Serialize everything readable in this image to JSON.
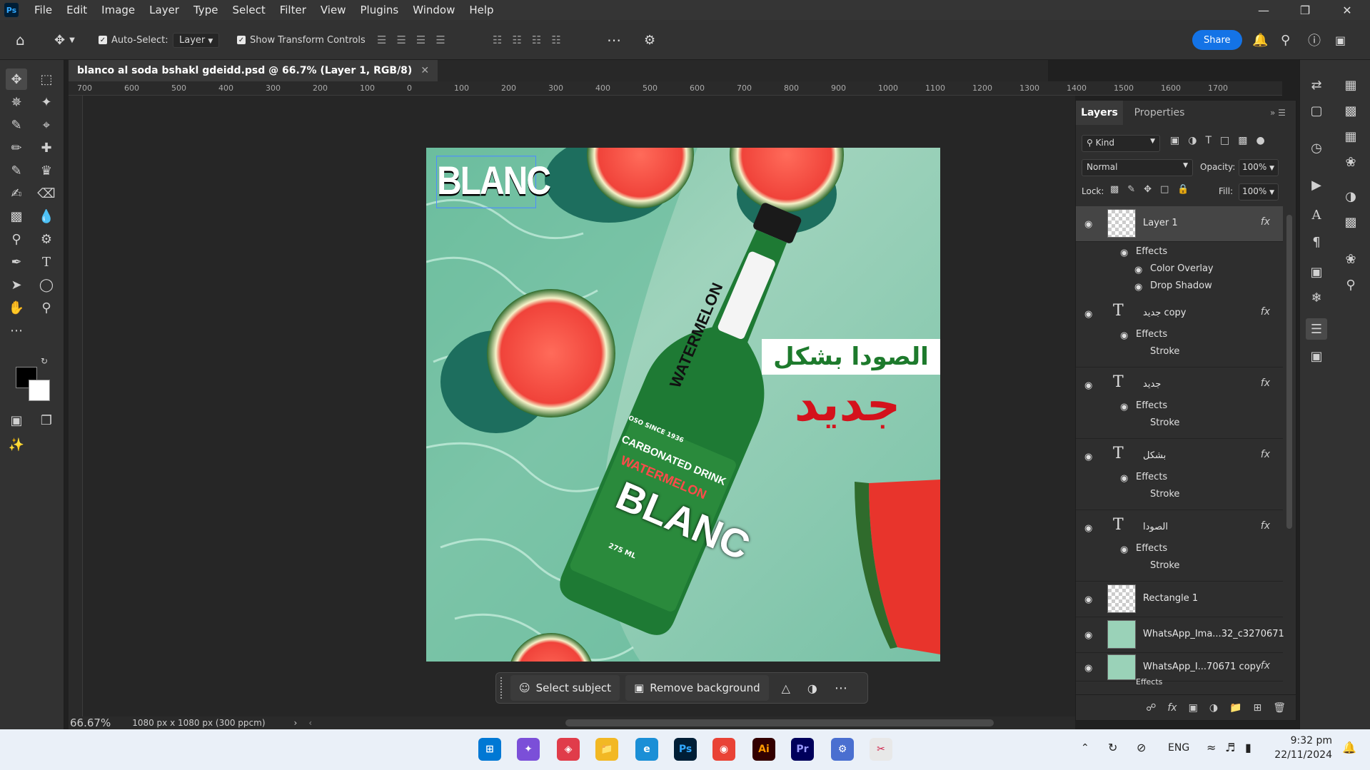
{
  "app": {
    "logo": "Ps"
  },
  "menu": [
    "File",
    "Edit",
    "Image",
    "Layer",
    "Type",
    "Select",
    "Filter",
    "View",
    "Plugins",
    "Window",
    "Help"
  ],
  "options": {
    "auto_select_label": "Auto-Select:",
    "auto_select_value": "Layer",
    "transform_label": "Show Transform Controls",
    "share_label": "Share"
  },
  "document": {
    "tab_title": "blanco al soda bshakl gdeidd.psd @ 66.7% (Layer 1, RGB/8)",
    "zoom": "66.67%",
    "size_info": "1080 px x 1080 px (300 ppcm)"
  },
  "ruler_h": [
    "700",
    "600",
    "500",
    "400",
    "300",
    "200",
    "100",
    "0",
    "100",
    "200",
    "300",
    "400",
    "500",
    "600",
    "700",
    "800",
    "900",
    "1000",
    "1100",
    "1200",
    "1300",
    "1400",
    "1500",
    "1600",
    "1700"
  ],
  "artwork": {
    "logo_text": "BLANC",
    "headline_1": "الصودا بشكل",
    "headline_2": "جديد",
    "bottle_label": "BLANC",
    "bottle_sub_1": "CARBONATED DRINK",
    "bottle_sub_2": "WATERMELON",
    "bottle_top": "WATERMELON",
    "bottle_volume": "275 ML",
    "bottle_since": "OSO SINCE 1936"
  },
  "context_bar": {
    "select_subject": "Select subject",
    "remove_background": "Remove background"
  },
  "panel": {
    "tab_layers": "Layers",
    "tab_properties": "Properties",
    "kind_label": "Kind",
    "blend_mode": "Normal",
    "opacity_label": "Opacity:",
    "opacity_value": "100%",
    "lock_label": "Lock:",
    "fill_label": "Fill:",
    "fill_value": "100%",
    "layers": [
      {
        "name": "Layer 1",
        "effects_label": "Effects",
        "effects": [
          "Color Overlay",
          "Drop Shadow"
        ]
      },
      {
        "name": "جديد copy",
        "effects_label": "Effects",
        "effects": [
          "Stroke"
        ]
      },
      {
        "name": "جديد",
        "effects_label": "Effects",
        "effects": [
          "Stroke"
        ]
      },
      {
        "name": "بشكل",
        "effects_label": "Effects",
        "effects": [
          "Stroke"
        ]
      },
      {
        "name": "الصودا",
        "effects_label": "Effects",
        "effects": [
          "Stroke"
        ]
      },
      {
        "name": "Rectangle 1"
      },
      {
        "name": "WhatsApp_Ima...32_c3270671"
      },
      {
        "name": "WhatsApp_I...70671 copy",
        "effects_label": "Effects"
      }
    ]
  },
  "taskbar": {
    "language": "ENG",
    "time": "9:32 pm",
    "date": "22/11/2024"
  },
  "colors": {
    "accent": "#1473e6",
    "text_red": "#d4121c",
    "text_green": "#1d7a2c",
    "canvas_bg": "#262626"
  }
}
